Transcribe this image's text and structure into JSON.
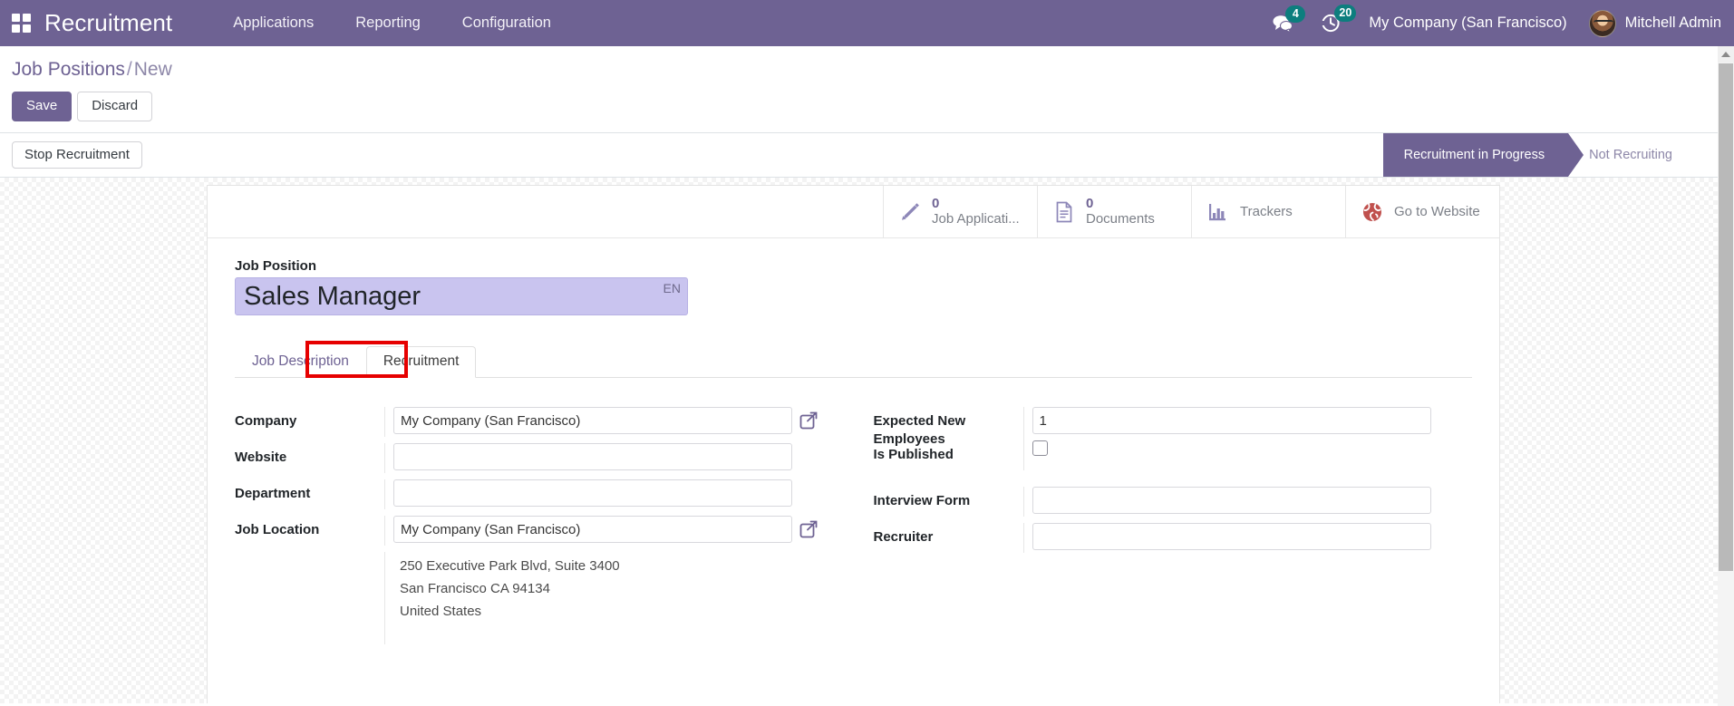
{
  "navbar": {
    "apps_icon": "apps-grid-icon",
    "brand": "Recruitment",
    "menu": [
      {
        "label": "Applications"
      },
      {
        "label": "Reporting"
      },
      {
        "label": "Configuration"
      }
    ],
    "messages_icon": "chat-bubbles-icon",
    "messages_count": "4",
    "activities_icon": "clock-activity-icon",
    "activities_count": "20",
    "company": "My Company (San Francisco)",
    "avatar": "user-avatar",
    "user": "Mitchell Admin",
    "accent_color": "#6e6293",
    "badge_color": "#0d7e7e"
  },
  "control_panel": {
    "breadcrumb_root": "Job Positions",
    "breadcrumb_sep": "/",
    "breadcrumb_current": "New",
    "save_label": "Save",
    "discard_label": "Discard"
  },
  "statusbar": {
    "stop_recruitment_label": "Stop Recruitment",
    "stages": [
      {
        "label": "Recruitment in Progress",
        "active": true
      },
      {
        "label": "Not Recruiting",
        "active": false
      }
    ]
  },
  "stat_buttons": [
    {
      "icon": "pencil-icon",
      "value": "0",
      "label": "Job Applicati...",
      "two_line": false
    },
    {
      "icon": "document-icon",
      "value": "0",
      "label": "Documents",
      "two_line": false
    },
    {
      "icon": "bar-chart-icon",
      "value": "",
      "label": "Trackers",
      "two_line": false
    },
    {
      "icon": "globe-icon",
      "value": "",
      "label": "Go to Website",
      "two_line": true
    }
  ],
  "title_field": {
    "label": "Job Position",
    "value": "Sales Manager",
    "lang_tag": "EN",
    "selection_color": "#c9c4ef"
  },
  "tabs": [
    {
      "label": "Job Description",
      "active": false
    },
    {
      "label": "Recruitment",
      "active": true,
      "highlight_color": "#e60000"
    }
  ],
  "form": {
    "left": [
      {
        "label": "Company",
        "value": "My Company (San Francisco)",
        "type": "many2one",
        "external_link": true
      },
      {
        "label": "Website",
        "value": "",
        "type": "many2one",
        "external_link": false
      },
      {
        "label": "Department",
        "value": "",
        "type": "many2one",
        "external_link": false
      },
      {
        "label": "Job Location",
        "value": "My Company (San Francisco)",
        "type": "many2one",
        "external_link": true
      }
    ],
    "address": [
      "250 Executive Park Blvd, Suite 3400",
      "San Francisco CA 94134",
      "United States"
    ],
    "right": [
      {
        "label": "Expected New Employees",
        "value": "1",
        "type": "integer"
      },
      {
        "label": "Is Published",
        "value": "",
        "type": "checkbox",
        "checked": false
      },
      {
        "label": "Interview Form",
        "value": "",
        "type": "many2one"
      },
      {
        "label": "Recruiter",
        "value": "",
        "type": "many2one"
      }
    ]
  },
  "scrollbar": {
    "up_arrow_icon": "chevron-up-icon"
  }
}
